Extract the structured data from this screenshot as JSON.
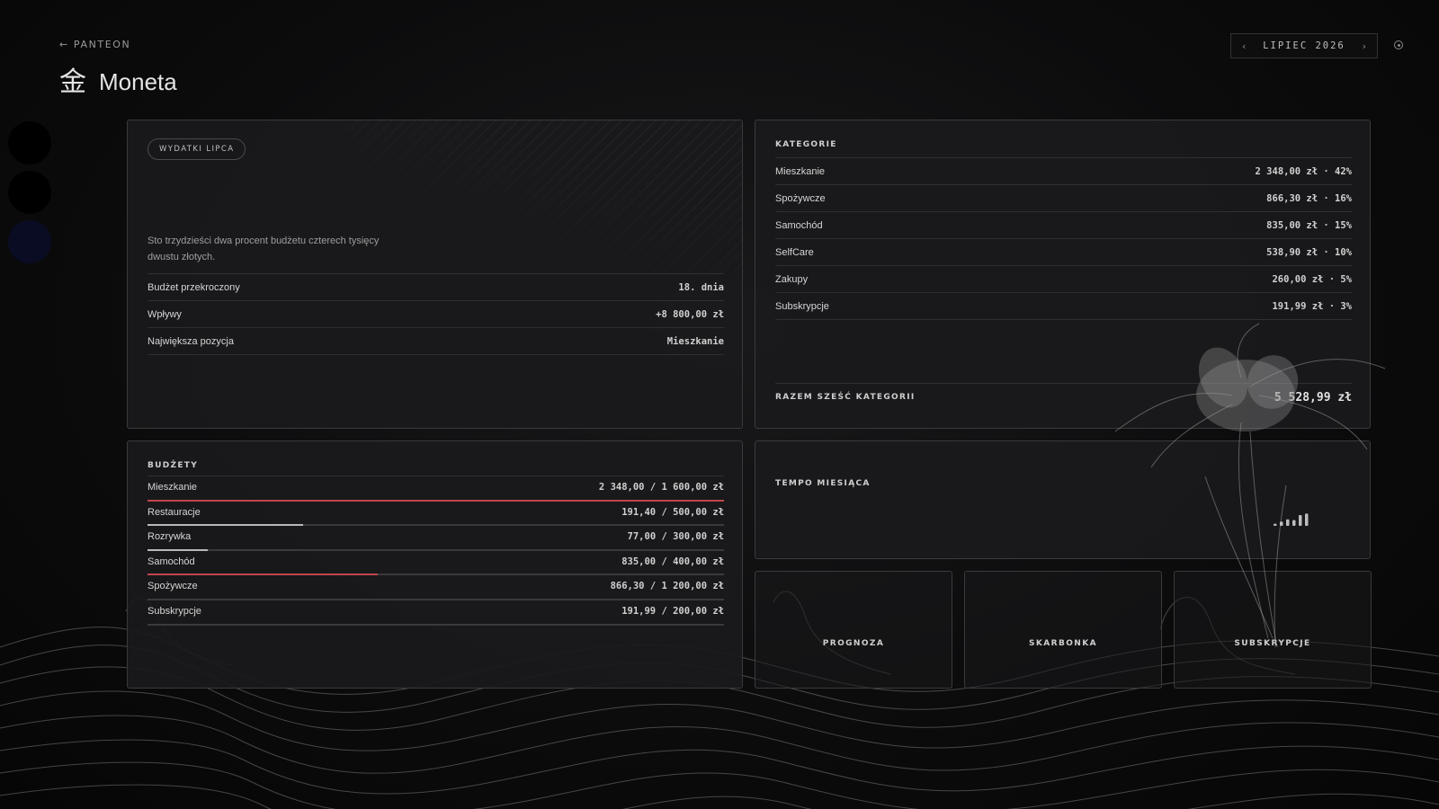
{
  "nav": {
    "back_label": "← PANTEON"
  },
  "header": {
    "glyph": "金",
    "title": "Moneta"
  },
  "month": {
    "prev": "‹",
    "label": "LIPIEC 2026",
    "next": "›"
  },
  "colors": {
    "over_budget": "#c0464c",
    "in_budget": "#b9b9b9",
    "track": "#3a3a3c",
    "dot_navy": "#0a0c24"
  },
  "expenses": {
    "pill": "WYDATKI LIPCA",
    "description": "Sto trzydzieści dwa procent budżetu czterech tysięcy dwustu złotych.",
    "rows": [
      {
        "key": "Budżet przekroczony",
        "value": "18. dnia"
      },
      {
        "key": "Wpływy",
        "value": "+8 800,00 zł"
      },
      {
        "key": "Największa pozycja",
        "value": "Mieszkanie"
      }
    ]
  },
  "categories": {
    "label": "KATEGORIE",
    "rows": [
      {
        "name": "Mieszkanie",
        "value": "2 348,00 zł · 42%"
      },
      {
        "name": "Spożywcze",
        "value": "866,30 zł · 16%"
      },
      {
        "name": "Samochód",
        "value": "835,00 zł · 15%"
      },
      {
        "name": "SelfCare",
        "value": "538,90 zł · 10%"
      },
      {
        "name": "Zakupy",
        "value": "260,00 zł · 5%"
      },
      {
        "name": "Subskrypcje",
        "value": "191,99 zł · 3%"
      }
    ],
    "total_label": "RAZEM SZEŚĆ KATEGORII",
    "total_value": "5 528,99 zł"
  },
  "budgets": {
    "label": "BUDŻETY",
    "rows": [
      {
        "name": "Mieszkanie",
        "value": "2 348,00 / 1 600,00 zł",
        "progress": 1.0,
        "over": true
      },
      {
        "name": "Restauracje",
        "value": "191,40 / 500,00 zł",
        "progress": 0.27,
        "over": false
      },
      {
        "name": "Rozrywka",
        "value": "77,00 / 300,00 zł",
        "progress": 0.105,
        "over": false
      },
      {
        "name": "Samochód",
        "value": "835,00 / 400,00 zł",
        "progress": 0.4,
        "over": true
      },
      {
        "name": "Spożywcze",
        "value": "866,30 / 1 200,00 zł",
        "progress": 0.0,
        "over": false
      },
      {
        "name": "Subskrypcje",
        "value": "191,99 / 200,00 zł",
        "progress": 0.0,
        "over": false
      }
    ]
  },
  "tempo": {
    "label": "TEMPO MIESIĄCA",
    "bars": [
      0.15,
      0.3,
      0.45,
      0.4,
      0.75,
      0.85
    ]
  },
  "tiles": [
    {
      "label": "PROGNOZA"
    },
    {
      "label": "SKARBONKA"
    },
    {
      "label": "SUBSKRYPCJE"
    }
  ]
}
